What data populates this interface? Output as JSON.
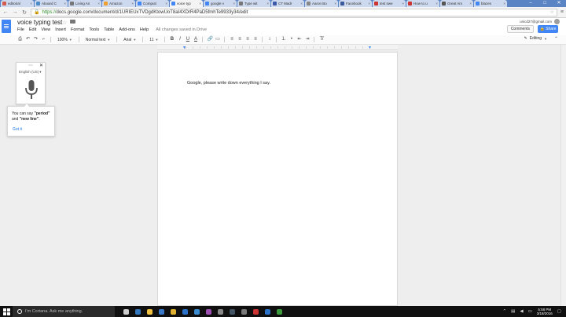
{
  "browser": {
    "tabs": [
      {
        "label": "editorial",
        "color": "#d35b4d"
      },
      {
        "label": "Aboard C",
        "color": "#4e8bc7"
      },
      {
        "label": "Living An",
        "color": "#777777"
      },
      {
        "label": "Amazon",
        "color": "#f0a030"
      },
      {
        "label": "Computi",
        "color": "#4285f4"
      },
      {
        "label": "voice typ",
        "color": "#4285f4",
        "active": true
      },
      {
        "label": "google v",
        "color": "#4285f4"
      },
      {
        "label": "Type wit",
        "color": "#777777"
      },
      {
        "label": "CT Madr",
        "color": "#3d5aa8"
      },
      {
        "label": "Aaron Bo",
        "color": "#888888"
      },
      {
        "label": "Facebook",
        "color": "#3b5998"
      },
      {
        "label": "test swe",
        "color": "#c33"
      },
      {
        "label": "How to u",
        "color": "#c33"
      },
      {
        "label": "Great Am",
        "color": "#555555"
      },
      {
        "label": "blazes",
        "color": "#4285f4"
      }
    ],
    "url_scheme": "https://",
    "url_rest": "docs.google.com/document/d/1URIEUxTVDgdKtowUoT8aI4XDrR4PaD5fmhTe9933y34/edit"
  },
  "docs": {
    "title": "voice typing test",
    "menu": [
      "File",
      "Edit",
      "View",
      "Insert",
      "Format",
      "Tools",
      "Table",
      "Add-ons",
      "Help"
    ],
    "saved_status": "All changes saved in Drive",
    "user_email": "unicd27@gmail.com",
    "comments_label": "Comments",
    "share_label": "Share",
    "toolbar": {
      "zoom": "100%",
      "style": "Normal text",
      "font": "Arial",
      "size": "11",
      "bold": "B",
      "italic": "I",
      "underline": "U",
      "text_color": "A"
    },
    "mode_label": "Editing",
    "body_text": "Google, please write down everything I say."
  },
  "voice_widget": {
    "language": "English (US)",
    "tip_prefix": "You can say ",
    "tip_period": "\"period\"",
    "tip_and": " and ",
    "tip_newline": "\"new line\"",
    "tip_suffix": ".",
    "got_it": "Got it"
  },
  "taskbar": {
    "cortana_placeholder": "I'm Cortana. Ask me anything.",
    "time": "5:58 PM",
    "date": "3/18/2016",
    "apps": [
      {
        "icon": "task-view-icon",
        "color": "#cccccc"
      },
      {
        "icon": "edge-icon",
        "color": "#3277bc"
      },
      {
        "icon": "file-explorer-icon",
        "color": "#f0c040"
      },
      {
        "icon": "store-icon",
        "color": "#3a78c8"
      },
      {
        "icon": "chrome-icon",
        "color": "#e0b030"
      },
      {
        "icon": "outlook-icon",
        "color": "#2a72c8"
      },
      {
        "icon": "onedrive-icon",
        "color": "#3a8ad0"
      },
      {
        "icon": "onenote-icon",
        "color": "#9c4fb0"
      },
      {
        "icon": "photos-icon",
        "color": "#888888"
      },
      {
        "icon": "steam-icon",
        "color": "#445566"
      },
      {
        "icon": "settings-icon",
        "color": "#7a7a7a"
      },
      {
        "icon": "music-icon",
        "color": "#cc3333"
      },
      {
        "icon": "calendar-icon",
        "color": "#2a72c8"
      },
      {
        "icon": "xbox-icon",
        "color": "#3c9a3c"
      }
    ]
  }
}
